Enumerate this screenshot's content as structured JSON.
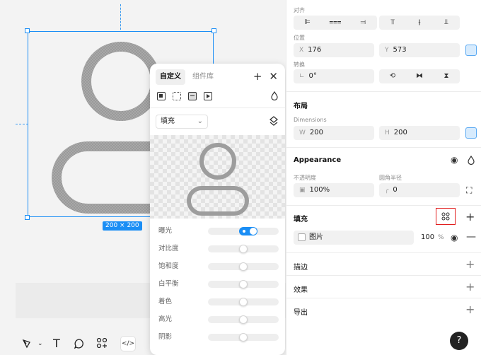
{
  "canvas": {
    "size_badge": "200 × 200"
  },
  "popover": {
    "tabs": [
      "自定义",
      "组件库"
    ],
    "active_tab": "自定义",
    "mode": "填充",
    "adjustments": [
      {
        "label": "曝光",
        "type": "toggle",
        "on": true
      },
      {
        "label": "对比度",
        "level": 0.5
      },
      {
        "label": "饱和度",
        "level": 0.5
      },
      {
        "label": "白平衡",
        "level": 0.5
      },
      {
        "label": "着色",
        "level": 0.5
      },
      {
        "label": "高光",
        "level": 0.5
      },
      {
        "label": "阴影",
        "level": 0.5
      }
    ]
  },
  "inspector": {
    "align_label": "对齐",
    "position_label": "位置",
    "x": {
      "prefix": "X",
      "value": "176"
    },
    "y": {
      "prefix": "Y",
      "value": "573"
    },
    "rotate_label": "转换",
    "rotation": "0°",
    "layout_title": "布局",
    "dimensions_label": "Dimensions",
    "w": {
      "prefix": "W",
      "value": "200"
    },
    "h": {
      "prefix": "H",
      "value": "200"
    },
    "appearance_title": "Appearance",
    "opacity_label": "不透明度",
    "radius_label": "圆角半径",
    "opacity": "100%",
    "radius": "0",
    "fill_title": "填充",
    "fill": {
      "name": "图片",
      "opacity": "100",
      "unit": "%"
    },
    "stroke_title": "描边",
    "effects_title": "效果",
    "export_title": "导出"
  },
  "help": "?",
  "colors": {
    "accent": "#1b8ef5",
    "highlight": "#e11d1d"
  }
}
